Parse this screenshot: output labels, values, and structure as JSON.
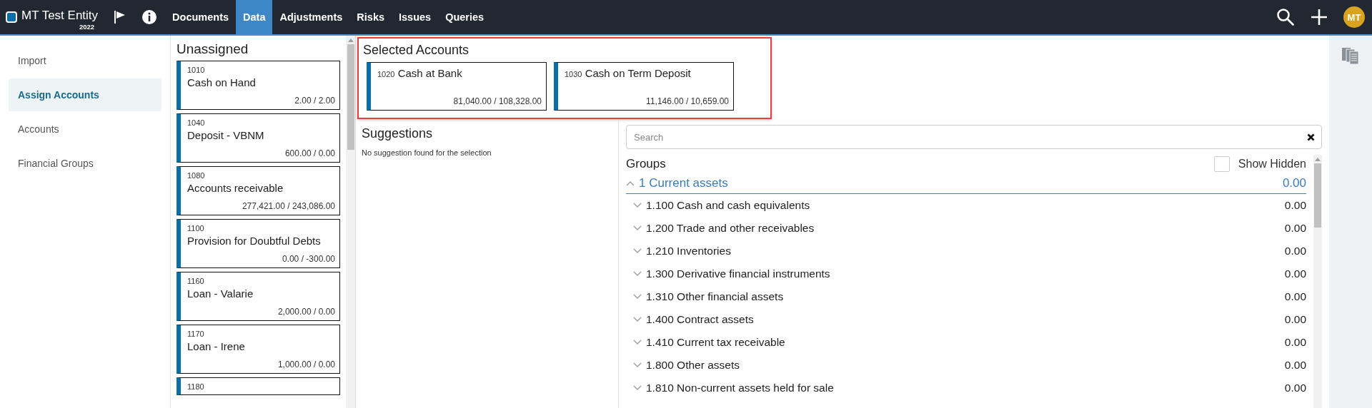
{
  "header": {
    "entity": "MT Test Entity",
    "year": "2022",
    "nav": [
      {
        "label": "Documents",
        "selected": false
      },
      {
        "label": "Data",
        "selected": true
      },
      {
        "label": "Adjustments",
        "selected": false
      },
      {
        "label": "Risks",
        "selected": false
      },
      {
        "label": "Issues",
        "selected": false
      },
      {
        "label": "Queries",
        "selected": false
      }
    ],
    "avatar": "MT"
  },
  "sidebar": {
    "items": [
      {
        "label": "Import",
        "selected": false
      },
      {
        "label": "Assign Accounts",
        "selected": true
      },
      {
        "label": "Accounts",
        "selected": false
      },
      {
        "label": "Financial Groups",
        "selected": false
      }
    ]
  },
  "unassigned": {
    "title": "Unassigned",
    "accounts": [
      {
        "code": "1010",
        "name": "Cash on Hand",
        "amounts": "2.00 / 2.00"
      },
      {
        "code": "1040",
        "name": "Deposit - VBNM",
        "amounts": "600.00 / 0.00"
      },
      {
        "code": "1080",
        "name": "Accounts receivable",
        "amounts": "277,421.00 / 243,086.00"
      },
      {
        "code": "1100",
        "name": "Provision for Doubtful Debts",
        "amounts": "0.00 / -300.00"
      },
      {
        "code": "1160",
        "name": "Loan - Valarie",
        "amounts": "2,000.00 / 0.00"
      },
      {
        "code": "1170",
        "name": "Loan - Irene",
        "amounts": "1,000.00 / 0.00"
      },
      {
        "code": "1180"
      }
    ]
  },
  "selected_accounts": {
    "title": "Selected Accounts",
    "accounts": [
      {
        "code": "1020",
        "name": "Cash at Bank",
        "amounts": "81,040.00 / 108,328.00"
      },
      {
        "code": "1030",
        "name": "Cash on Term Deposit",
        "amounts": "11,146.00 / 10,659.00"
      }
    ]
  },
  "suggestions": {
    "title": "Suggestions",
    "message": "No suggestion found for the selection"
  },
  "search": {
    "placeholder": "Search"
  },
  "groups": {
    "title": "Groups",
    "show_hidden": {
      "label": "Show Hidden",
      "checked": false
    },
    "items": [
      {
        "label": "1 Current assets",
        "total": "0.00",
        "expanded": true,
        "children": [
          {
            "label": "1.100 Cash and cash equivalents",
            "total": "0.00",
            "expanded": false
          },
          {
            "label": "1.200 Trade and other receivables",
            "total": "0.00",
            "expanded": false
          },
          {
            "label": "1.210 Inventories",
            "total": "0.00",
            "expanded": false
          },
          {
            "label": "1.300 Derivative financial instruments",
            "total": "0.00",
            "expanded": false
          },
          {
            "label": "1.310 Other financial assets",
            "total": "0.00",
            "expanded": false
          },
          {
            "label": "1.400 Contract assets",
            "total": "0.00",
            "expanded": false
          },
          {
            "label": "1.410 Current tax receivable",
            "total": "0.00",
            "expanded": false
          },
          {
            "label": "1.800 Other assets",
            "total": "0.00",
            "expanded": false
          },
          {
            "label": "1.810 Non-current assets held for sale",
            "total": "0.00",
            "expanded": false
          }
        ]
      }
    ]
  }
}
